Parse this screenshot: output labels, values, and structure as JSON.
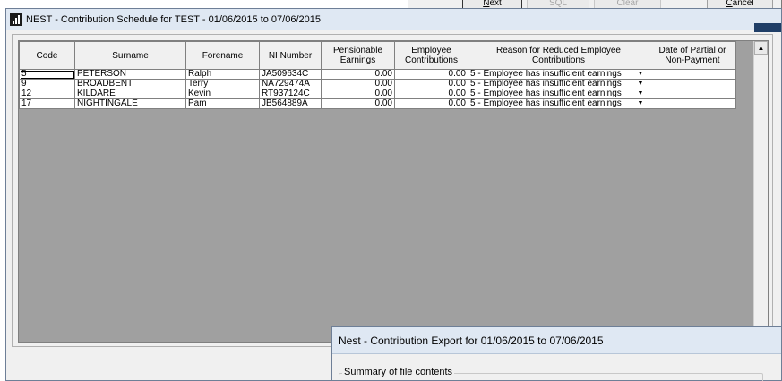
{
  "back_window": {
    "buttons": [
      {
        "label": "Next",
        "underline": "N",
        "rest": "ext",
        "disabled": false
      },
      {
        "label": "SQL",
        "disabled": true
      },
      {
        "label": "Clear",
        "disabled": true
      },
      {
        "label": "Cancel",
        "underline": "C",
        "rest": "ancel",
        "disabled": false
      }
    ]
  },
  "main_window": {
    "title": "NEST - Contribution Schedule for TEST - 01/06/2015 to 07/06/2015"
  },
  "grid": {
    "columns": [
      "Code",
      "Surname",
      "Forename",
      "NI Number",
      "Pensionable Earnings",
      "Employee Contributions",
      "Reason for Reduced Employee Contributions",
      "Date of Partial or Non-Payment"
    ],
    "rows": [
      {
        "code": "5",
        "surname": "PETERSON",
        "forename": "Ralph",
        "ni": "JA509634C",
        "earnings": "0.00",
        "contrib": "0.00",
        "reason": "5 - Employee has insufficient earnings",
        "date": ""
      },
      {
        "code": "9",
        "surname": "BROADBENT",
        "forename": "Terry",
        "ni": "NA729474A",
        "earnings": "0.00",
        "contrib": "0.00",
        "reason": "5 - Employee has insufficient earnings",
        "date": ""
      },
      {
        "code": "12",
        "surname": "KILDARE",
        "forename": "Kevin",
        "ni": "RT937124C",
        "earnings": "0.00",
        "contrib": "0.00",
        "reason": "5 - Employee has insufficient earnings",
        "date": ""
      },
      {
        "code": "17",
        "surname": "NIGHTINGALE",
        "forename": "Pam",
        "ni": "JB564889A",
        "earnings": "0.00",
        "contrib": "0.00",
        "reason": "5 - Employee has insufficient earnings",
        "date": ""
      }
    ]
  },
  "export_dialog": {
    "title": "Nest - Contribution Export for 01/06/2015 to 07/06/2015",
    "group_label": "Summary of file contents"
  }
}
